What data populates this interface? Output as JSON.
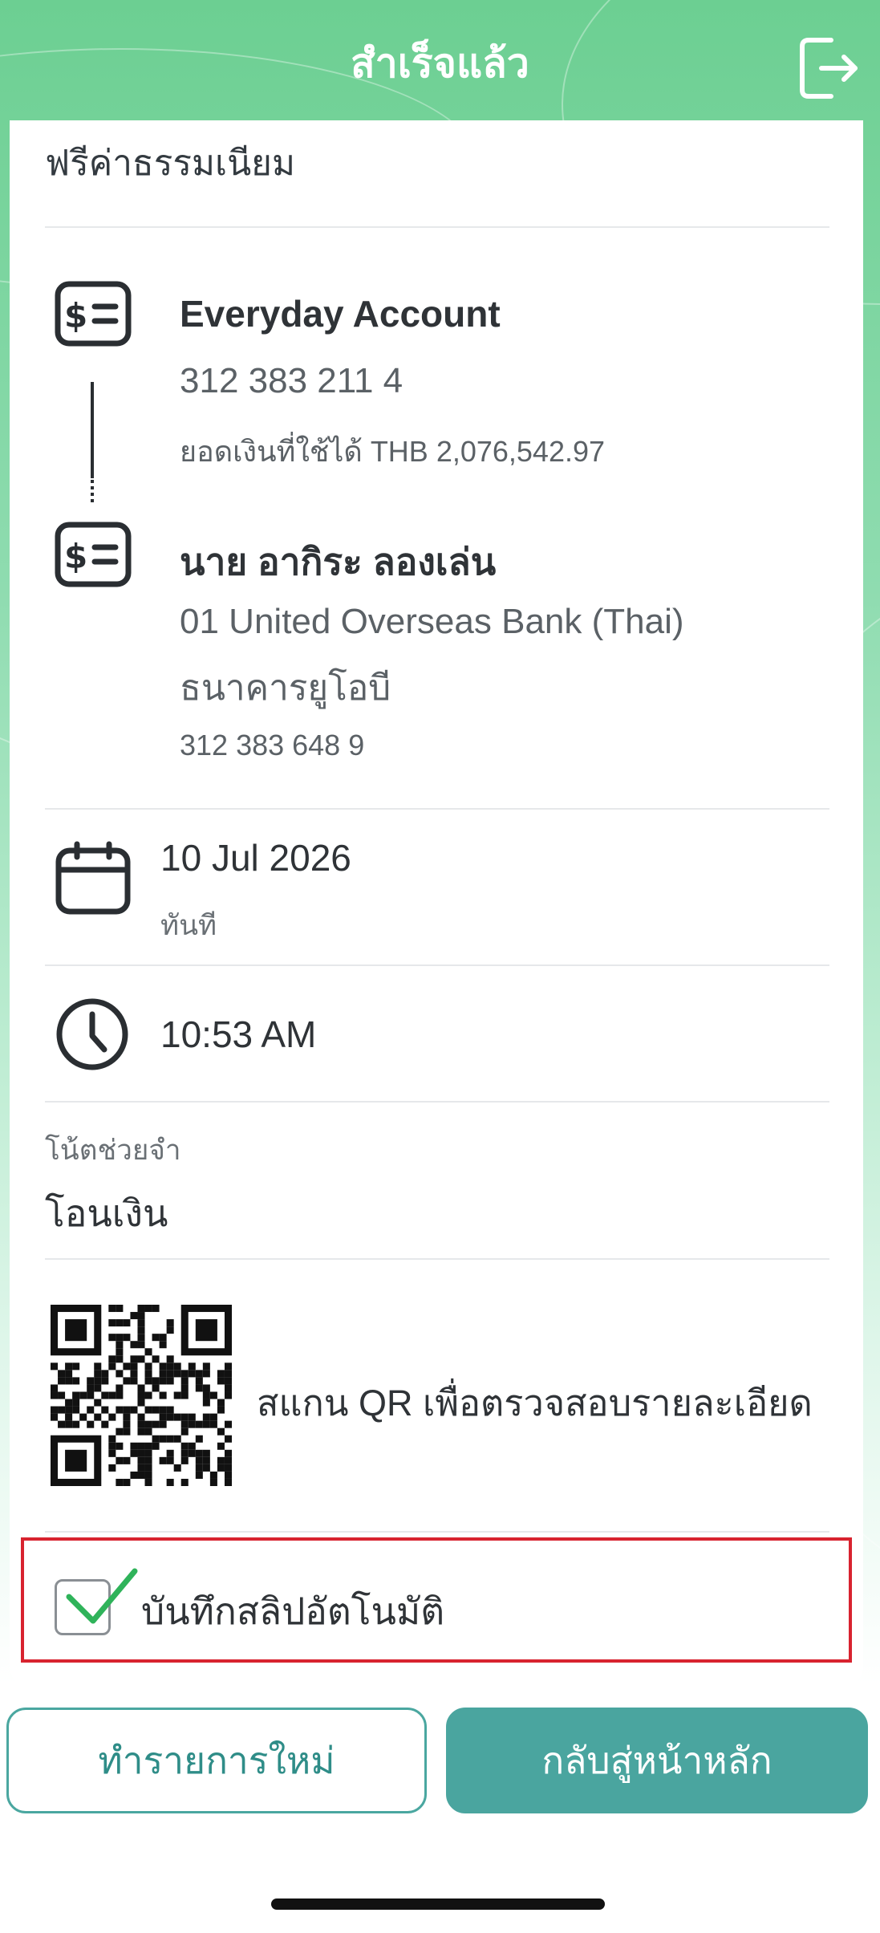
{
  "header": {
    "title": "สำเร็จแล้ว",
    "logout_icon": "logout-icon"
  },
  "fee": {
    "text": "ฟรีค่าธรรมเนียม"
  },
  "from_account": {
    "icon": "money-account-icon",
    "name": "Everyday Account",
    "number": "312 383 211 4",
    "balance": "ยอดเงินที่ใช้ได้ THB 2,076,542.97"
  },
  "to_account": {
    "icon": "money-account-icon",
    "name": "นาย อากิระ ลองเล่น",
    "bank_en": "01 United Overseas Bank (Thai)",
    "bank_th": "ธนาคารยูโอบี",
    "number": "312 383 648 9"
  },
  "date": {
    "icon": "calendar-icon",
    "value": "10 Jul 2026",
    "sub": "ทันที"
  },
  "time": {
    "icon": "clock-icon",
    "value": "10:53 AM"
  },
  "note": {
    "label": "โน้ตช่วยจำ",
    "value": "โอนเงิน"
  },
  "qr": {
    "icon": "qr-code",
    "text": "สแกน QR เพื่อตรวจสอบรายละเอียด"
  },
  "auto_save": {
    "label": "บันทึกสลิปอัตโนมัติ",
    "checked": true,
    "check_color": "#2fb35a",
    "highlight_color": "#d8232f"
  },
  "buttons": {
    "new_transaction": "ทำรายการใหม่",
    "home": "กลับสู่หน้าหลัก"
  },
  "colors": {
    "header_green": "#6ccf92",
    "primary_teal": "#4aa59f"
  }
}
